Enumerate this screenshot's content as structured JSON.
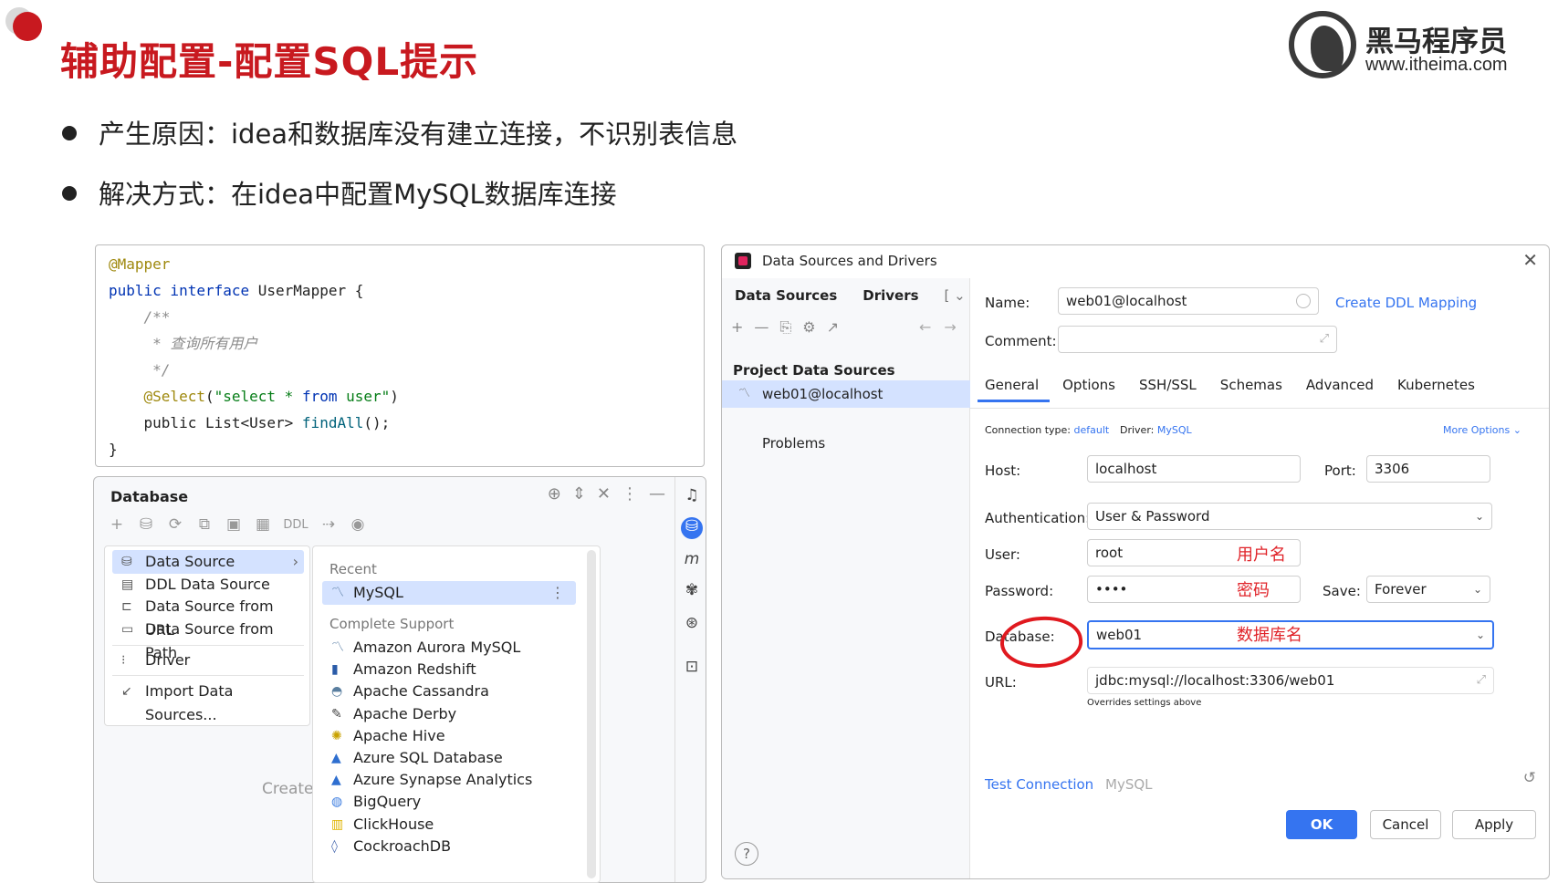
{
  "slide": {
    "title": "辅助配置-配置SQL提示",
    "logo": {
      "name": "黑马程序员",
      "url": "www.itheima.com"
    },
    "bullets": [
      "产生原因：idea和数据库没有建立连接，不识别表信息",
      "解决方式：在idea中配置MySQL数据库连接"
    ]
  },
  "code": {
    "lines": [
      {
        "parts": [
          [
            "ann",
            "@Mapper"
          ]
        ]
      },
      {
        "parts": [
          [
            "kw",
            "public interface "
          ],
          [
            "",
            "UserMapper {"
          ]
        ]
      },
      {
        "parts": [
          [
            "cm",
            "    /**"
          ]
        ]
      },
      {
        "parts": [
          [
            "cm",
            "     * 查询所有用户"
          ]
        ]
      },
      {
        "parts": [
          [
            "cm",
            "     */"
          ]
        ]
      },
      {
        "parts": [
          [
            "ann",
            "    @Select"
          ],
          [
            "",
            "("
          ],
          [
            "str",
            "\"select * "
          ],
          [
            "kw",
            "from"
          ],
          [
            "str",
            " user\""
          ],
          [
            "",
            ")"
          ]
        ]
      },
      {
        "parts": [
          [
            "",
            "    public List<User> "
          ],
          [
            "fn",
            "findAll"
          ],
          [
            "",
            "();"
          ]
        ]
      },
      {
        "parts": [
          [
            "",
            "}"
          ]
        ]
      }
    ]
  },
  "database_panel": {
    "title": "Database",
    "ddl_label": "DDL",
    "create_text": "Create",
    "menu": [
      {
        "label": "Data Source",
        "icon": "database-icon",
        "selected": true,
        "has_submenu": true
      },
      {
        "label": "DDL Data Source",
        "icon": "ddl-icon"
      },
      {
        "label": "Data Source from URL",
        "icon": "url-icon"
      },
      {
        "label": "Data Source from Path",
        "icon": "folder-icon"
      },
      {
        "label": "Driver",
        "icon": "driver-icon"
      },
      {
        "label": "Import Data Sources...",
        "icon": "import-icon"
      }
    ],
    "submenu": {
      "recent_header": "Recent",
      "recent": [
        {
          "label": "MySQL",
          "icon": "mysql-icon",
          "selected": true
        }
      ],
      "complete_header": "Complete Support",
      "complete": [
        {
          "label": "Amazon Aurora MySQL",
          "icon": "aurora-icon"
        },
        {
          "label": "Amazon Redshift",
          "icon": "redshift-icon"
        },
        {
          "label": "Apache Cassandra",
          "icon": "cassandra-icon"
        },
        {
          "label": "Apache Derby",
          "icon": "derby-icon"
        },
        {
          "label": "Apache Hive",
          "icon": "hive-icon"
        },
        {
          "label": "Azure SQL Database",
          "icon": "azure-icon"
        },
        {
          "label": "Azure Synapse Analytics",
          "icon": "azure-synapse-icon"
        },
        {
          "label": "BigQuery",
          "icon": "bigquery-icon"
        },
        {
          "label": "ClickHouse",
          "icon": "clickhouse-icon"
        },
        {
          "label": "CockroachDB",
          "icon": "cockroach-icon"
        }
      ]
    }
  },
  "dialog": {
    "title": "Data Sources and Drivers",
    "left": {
      "tabs": [
        "Data Sources",
        "Drivers"
      ],
      "section": "Project Data Sources",
      "item": "web01@localhost",
      "problems": "Problems"
    },
    "form": {
      "name_label": "Name:",
      "name_value": "web01@localhost",
      "create_ddl_link": "Create DDL Mapping",
      "comment_label": "Comment:",
      "comment_value": "",
      "tabs": [
        "General",
        "Options",
        "SSH/SSL",
        "Schemas",
        "Advanced",
        "Kubernetes"
      ],
      "active_tab": "General",
      "connection_type_label": "Connection type:",
      "connection_type_value": "default",
      "driver_label": "Driver:",
      "driver_value": "MySQL",
      "more_options": "More Options",
      "host_label": "Host:",
      "host_value": "localhost",
      "port_label": "Port:",
      "port_value": "3306",
      "auth_label": "Authentication:",
      "auth_value": "User & Password",
      "user_label": "User:",
      "user_value": "root",
      "user_note": "用户名",
      "password_label": "Password:",
      "password_value": "••••",
      "password_note": "密码",
      "save_label": "Save:",
      "save_value": "Forever",
      "database_label": "Database:",
      "database_value": "web01",
      "database_note": "数据库名",
      "url_label": "URL:",
      "url_value": "jdbc:mysql://localhost:3306/web01",
      "url_hint": "Overrides settings above"
    },
    "footer": {
      "test_connection": "Test Connection",
      "driver_name": "MySQL",
      "help": "?",
      "ok": "OK",
      "cancel": "Cancel",
      "apply": "Apply"
    }
  },
  "colors": {
    "brand_red": "#c8191f",
    "accent_blue": "#3574f0",
    "selection": "#d4e2ff",
    "annotation_red": "#e0242a"
  }
}
